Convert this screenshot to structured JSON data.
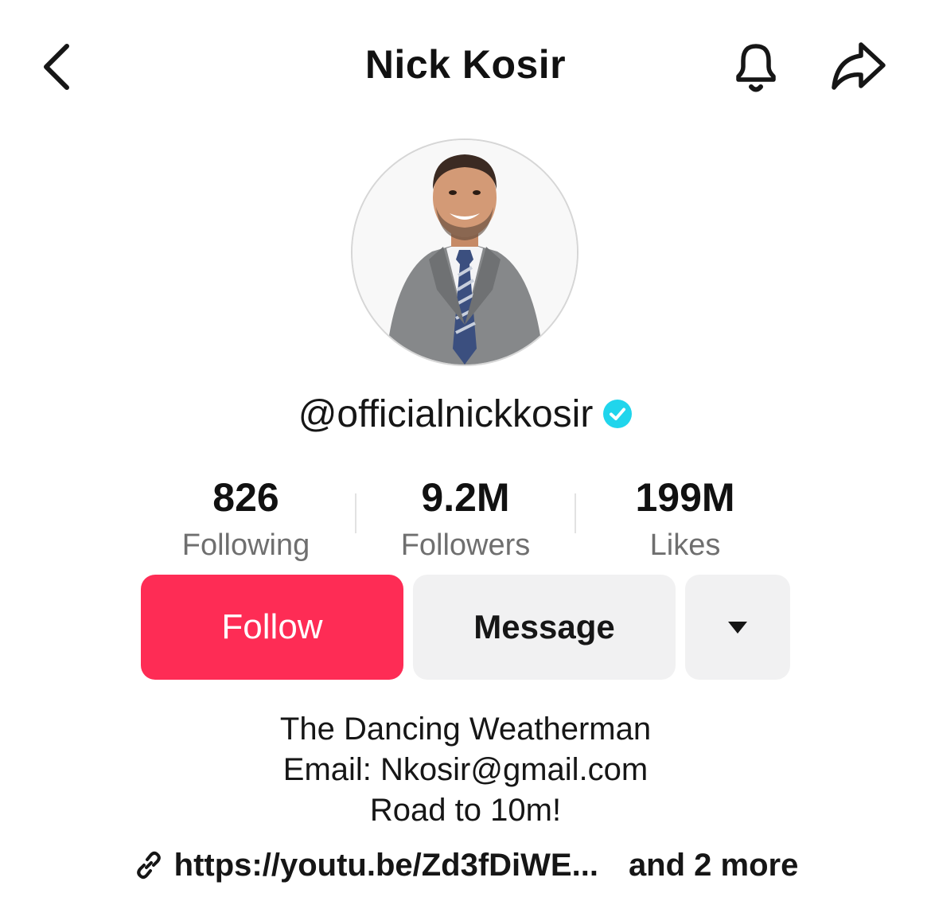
{
  "header": {
    "title": "Nick Kosir",
    "back_icon": "chevron-left-icon",
    "notify_icon": "bell-icon",
    "share_icon": "share-arrow-icon"
  },
  "profile": {
    "handle": "@officialnickkosir",
    "verified": true,
    "verified_color": "#20d5ec"
  },
  "stats": [
    {
      "value": "826",
      "label": "Following"
    },
    {
      "value": "9.2M",
      "label": "Followers"
    },
    {
      "value": "199M",
      "label": "Likes"
    }
  ],
  "actions": {
    "follow_label": "Follow",
    "message_label": "Message",
    "more_icon": "caret-down-icon",
    "follow_color": "#fe2c55"
  },
  "bio": {
    "lines": [
      "The Dancing Weatherman",
      "Email: Nkosir@gmail.com",
      "Road to 10m!"
    ]
  },
  "links": {
    "icon": "link-icon",
    "url": "https://youtu.be/Zd3fDiWE...",
    "more": "and 2 more"
  }
}
